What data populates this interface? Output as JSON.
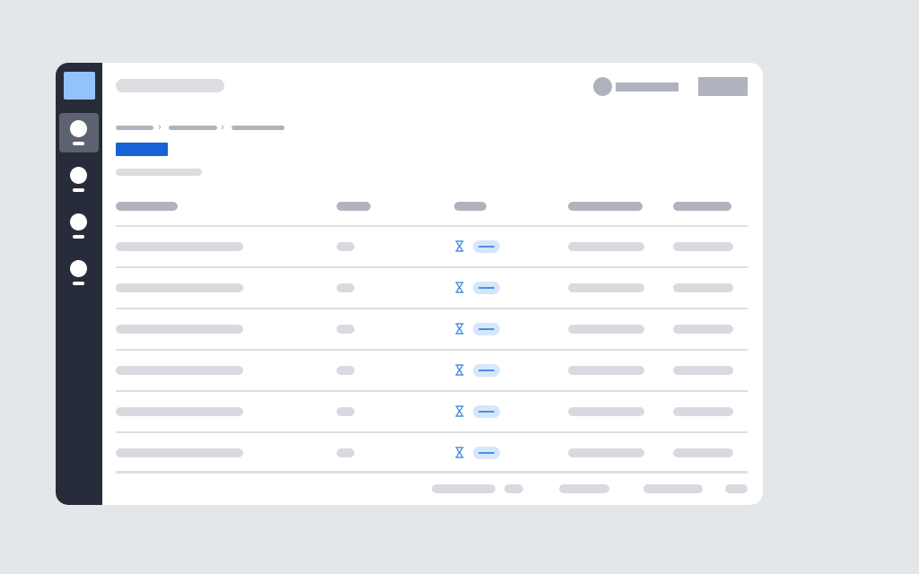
{
  "app": {
    "sidebar": {
      "logo_icon": "app-logo",
      "nav_items": [
        {
          "icon": "nav-icon",
          "active": true
        },
        {
          "icon": "nav-icon",
          "active": false
        },
        {
          "icon": "nav-icon",
          "active": false
        },
        {
          "icon": "nav-icon",
          "active": false
        }
      ]
    },
    "header": {
      "title": "",
      "user_avatar_icon": "user-avatar",
      "user_name": "",
      "action_label": ""
    },
    "breadcrumb": [
      "",
      "",
      ""
    ],
    "breadcrumb_separator": "›",
    "primary_action_label": "",
    "subtitle": "",
    "table": {
      "columns": [
        "",
        "",
        "",
        "",
        ""
      ],
      "status_icon": "hourglass-icon",
      "rows": [
        {
          "status": "pending"
        },
        {
          "status": "pending"
        },
        {
          "status": "pending"
        },
        {
          "status": "pending"
        },
        {
          "status": "pending"
        },
        {
          "status": "pending"
        }
      ]
    },
    "pagination": [
      "",
      "",
      "",
      "",
      ""
    ],
    "colors": {
      "background": "#e3e7ea",
      "sidebar": "#262c3a",
      "logo": "#94c3fb",
      "primary": "#1662d6",
      "status_pending_fill": "#d6e6fb",
      "status_pending_accent": "#4a90e2"
    }
  }
}
